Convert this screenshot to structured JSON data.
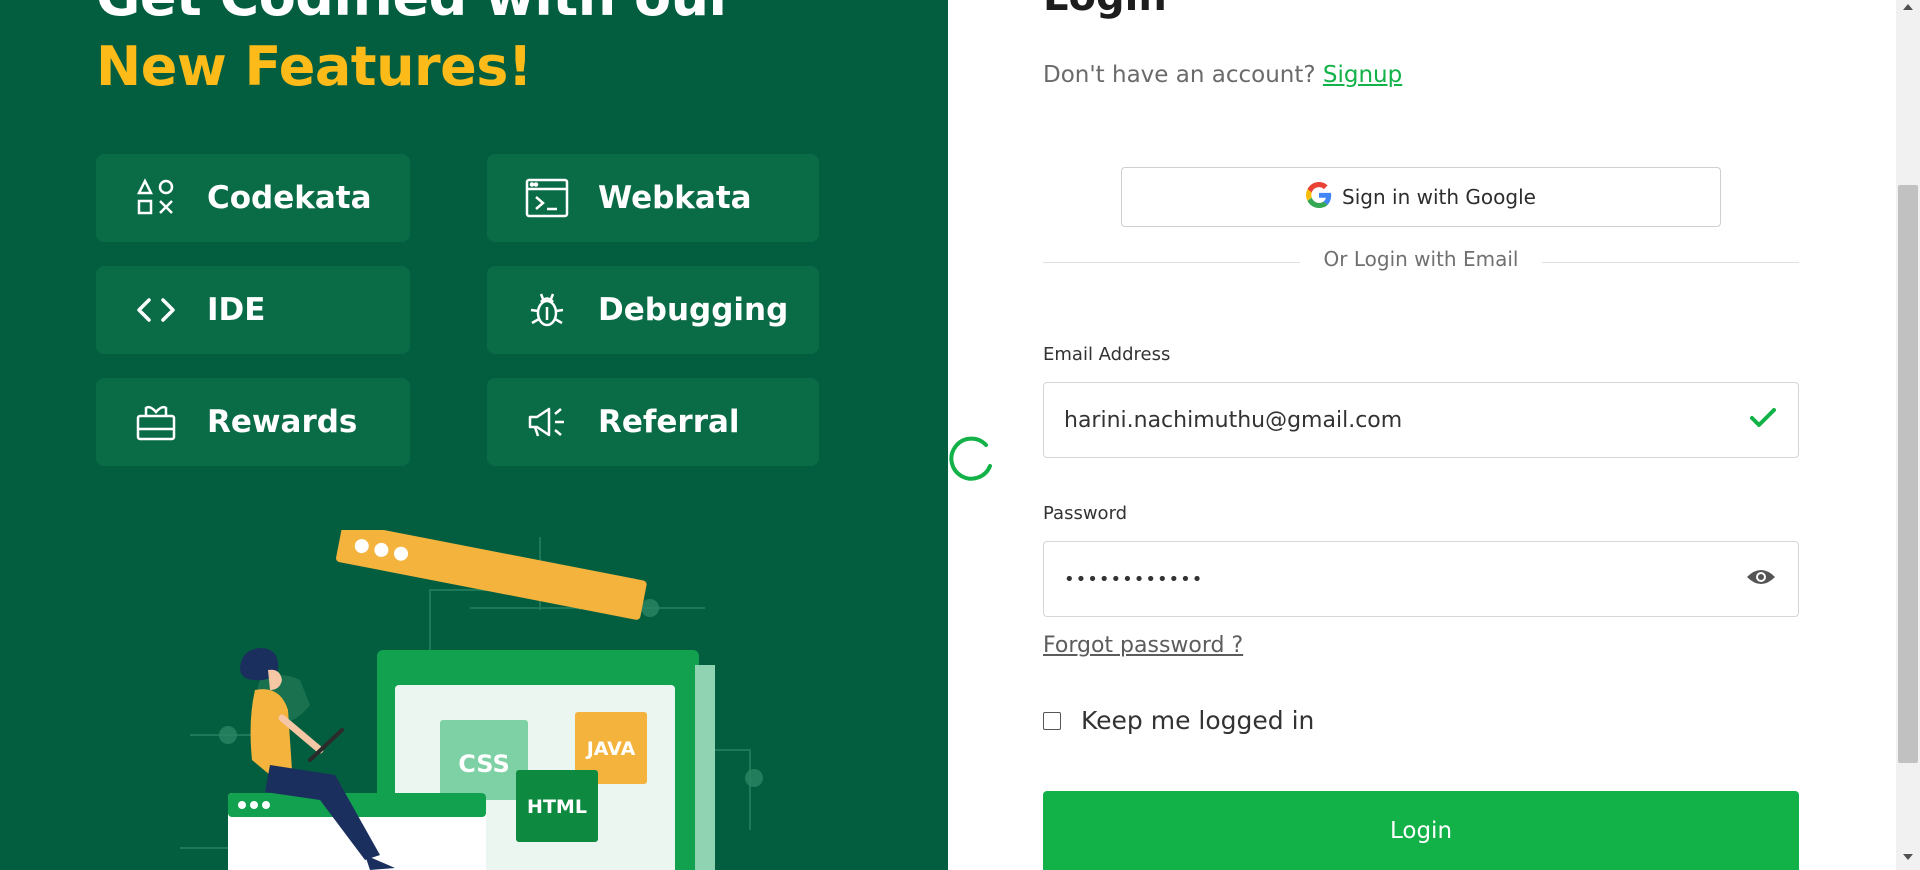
{
  "left_panel": {
    "headline_line1": "Get Codified with our",
    "headline_line2": "New Features!",
    "features": [
      {
        "label": "Codekata",
        "icon": "shapes-icon"
      },
      {
        "label": "Webkata",
        "icon": "terminal-window-icon"
      },
      {
        "label": "IDE",
        "icon": "code-brackets-icon"
      },
      {
        "label": "Debugging",
        "icon": "bug-icon"
      },
      {
        "label": "Rewards",
        "icon": "gift-icon"
      },
      {
        "label": "Referral",
        "icon": "megaphone-icon"
      }
    ],
    "illustration": {
      "labels": {
        "css": "CSS",
        "java": "JAVA",
        "html": "HTML"
      }
    },
    "colors": {
      "background": "#035e40",
      "card": "#0a6b47",
      "accent": "#fdbb19"
    }
  },
  "login": {
    "title": "Login",
    "signup_prompt": "Don't have an account?",
    "signup_link": "Signup",
    "google_button": "Sign in with Google",
    "divider_text": "Or Login with Email",
    "email_label": "Email Address",
    "email_value": "harini.nachimuthu@gmail.com",
    "password_label": "Password",
    "password_value": "••••••••••••",
    "forgot_password": "Forgot password ?",
    "keep_logged_in": "Keep me logged in",
    "login_button": "Login",
    "colors": {
      "primary": "#12b249"
    }
  }
}
